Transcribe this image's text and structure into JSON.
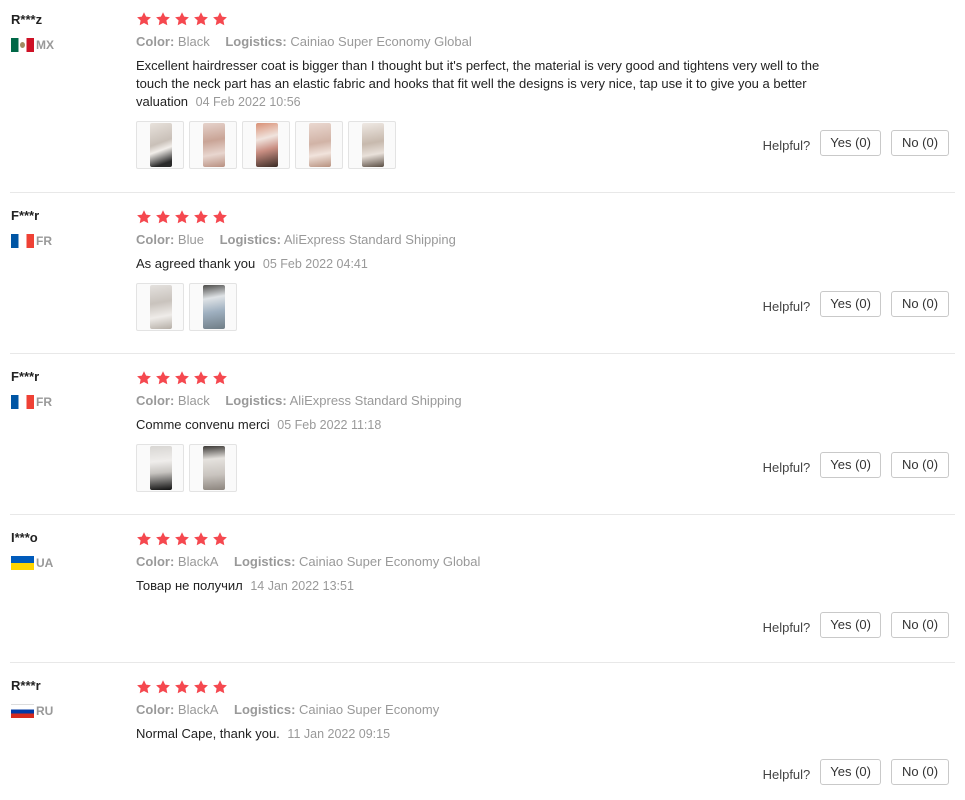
{
  "colors": {
    "star": "#f5484f",
    "muted": "#999999",
    "divider": "#e8e8e8"
  },
  "labels": {
    "color": "Color:",
    "logistics": "Logistics:",
    "helpful": "Helpful?"
  },
  "reviews": [
    {
      "user": "R***z",
      "country": "MX",
      "flag": "mexico-flag-icon",
      "rating": 5,
      "color": "Black",
      "logistics": "Cainiao Super Economy Global",
      "text": "Excellent hairdresser coat is bigger than I thought but it's perfect, the material is very good and tightens very well to the touch the neck part has an elastic fabric and hooks that fit well the designs is very nice, tap use it to give you a better valuation",
      "date": "04 Feb 2022 10:56",
      "photos": 5,
      "yes": "Yes (0)",
      "no": "No (0)"
    },
    {
      "user": "F***r",
      "country": "FR",
      "flag": "france-flag-icon",
      "rating": 5,
      "color": "Blue",
      "logistics": "AliExpress Standard Shipping",
      "text": "As agreed thank you",
      "date": "05 Feb 2022 04:41",
      "photos": 2,
      "yes": "Yes (0)",
      "no": "No (0)"
    },
    {
      "user": "F***r",
      "country": "FR",
      "flag": "france-flag-icon",
      "rating": 5,
      "color": "Black",
      "logistics": "AliExpress Standard Shipping",
      "text": "Comme convenu merci",
      "date": "05 Feb 2022 11:18",
      "photos": 2,
      "yes": "Yes (0)",
      "no": "No (0)"
    },
    {
      "user": "I***o",
      "country": "UA",
      "flag": "ukraine-flag-icon",
      "rating": 5,
      "color": "BlackA",
      "logistics": "Cainiao Super Economy Global",
      "text": "Товар не получил",
      "date": "14 Jan 2022 13:51",
      "photos": 0,
      "yes": "Yes (0)",
      "no": "No (0)"
    },
    {
      "user": "R***r",
      "country": "RU",
      "flag": "russia-flag-icon",
      "rating": 5,
      "color": "BlackA",
      "logistics": "Cainiao Super Economy",
      "text": "Normal Cape, thank you.",
      "date": "11 Jan 2022 09:15",
      "photos": 0,
      "yes": "Yes (0)",
      "no": "No (0)"
    }
  ]
}
